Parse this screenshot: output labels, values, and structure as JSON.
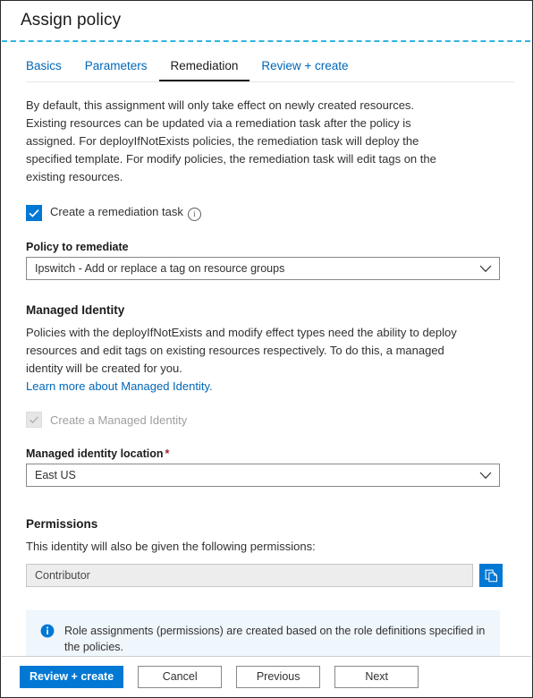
{
  "window": {
    "title": "Assign policy"
  },
  "tabs": [
    {
      "label": "Basics",
      "active": false
    },
    {
      "label": "Parameters",
      "active": false
    },
    {
      "label": "Remediation",
      "active": true
    },
    {
      "label": "Review + create",
      "active": false
    }
  ],
  "intro": {
    "paragraph": "By default, this assignment will only take effect on newly created resources. Existing resources can be updated via a remediation task after the policy is assigned. For deployIfNotExists policies, the remediation task will deploy the specified template. For modify policies, the remediation task will edit tags on the existing resources."
  },
  "remediation": {
    "checkbox_label": "Create a remediation task",
    "checkbox_checked": true,
    "info_icon_glyph": "i",
    "policy_label": "Policy to remediate",
    "policy_value": "Ipswitch - Add or replace a tag on resource groups"
  },
  "managed_identity": {
    "heading": "Managed Identity",
    "paragraph": "Policies with the deployIfNotExists and modify effect types need the ability to deploy resources and edit tags on existing resources respectively. To do this, a managed identity will be created for you.",
    "link_text": "Learn more about Managed Identity.",
    "checkbox_label": "Create a Managed Identity",
    "checkbox_checked": true,
    "checkbox_disabled": true,
    "location_label": "Managed identity location",
    "location_required_mark": "*",
    "location_value": "East US"
  },
  "permissions": {
    "heading": "Permissions",
    "paragraph": "This identity will also be given the following permissions:",
    "role_value": "Contributor",
    "copy_icon": "copy-icon"
  },
  "banner": {
    "icon": "info-circle-icon",
    "text": "Role assignments (permissions) are created based on the role definitions specified in the policies."
  },
  "footer": {
    "review_create_label": "Review + create",
    "cancel_label": "Cancel",
    "previous_label": "Previous",
    "next_label": "Next"
  },
  "colors": {
    "accent": "#0078d4",
    "link": "#0067b8",
    "dashed_rule": "#2fb4e0",
    "required": "#a4262c",
    "banner_bg": "#eff6fc"
  }
}
